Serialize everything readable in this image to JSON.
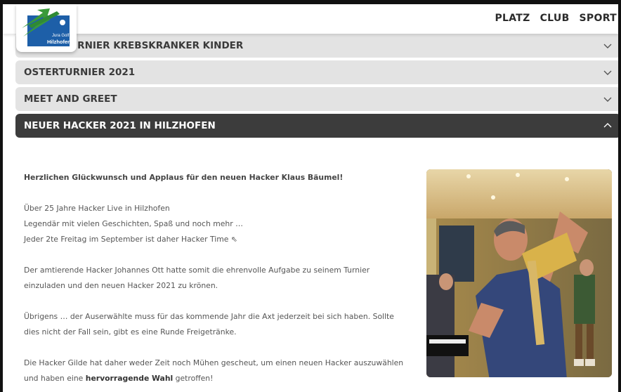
{
  "header": {
    "nav": [
      "PLATZ",
      "CLUB",
      "SPORT"
    ],
    "logo": {
      "line1": "Jura Golf",
      "line2": "Hilzhofen"
    }
  },
  "accordion": [
    {
      "label": "TURNIER KREBSKRANKER KINDER",
      "state": "collapsed"
    },
    {
      "label": "OSTERTURNIER 2021",
      "state": "collapsed"
    },
    {
      "label": "MEET AND GREET",
      "state": "collapsed"
    },
    {
      "label": "NEUER HACKER 2021 IN HILZHOFEN",
      "state": "expanded"
    }
  ],
  "content": {
    "intro": "Herzlichen Glückwunsch und Applaus für den neuen Hacker Klaus Bäumel!",
    "p1": [
      "Über 25 Jahre Hacker Live in Hilzhofen",
      "Legendär mit vielen Geschichten, Spaß und noch mehr …",
      "Jeder 2te Freitag im September ist daher Hacker Time ⇖"
    ],
    "p2": [
      "Der amtierende Hacker Johannes Ott hatte somit die ehrenvolle Aufgabe zu seinem Turnier",
      "einzuladen und den neuen Hacker 2021 zu krönen."
    ],
    "p3": [
      "Übrigens … der Auserwählte muss für das kommende Jahr die Axt jederzeit bei sich haben. Sollte",
      "dies nicht der Fall sein, gibt es eine Runde Freigetränke."
    ],
    "p4_line1": "Die Hacker Gilde hat daher weder Zeit noch Mühen gescheut, um einen neuen Hacker auszuwählen",
    "p4_line2_pre": "und haben eine ",
    "p4_line2_bold": "hervorragende Wahl",
    "p4_line2_post": " getroffen!"
  },
  "colors": {
    "accent": "#3c3c3c",
    "accordion_bg": "#e3e3e3",
    "logo_blue": "#1d5fa8",
    "logo_green": "#3a9a3a"
  },
  "icons": {
    "chevron_collapsed": "chevron-down-icon",
    "chevron_expanded": "chevron-up-icon"
  }
}
